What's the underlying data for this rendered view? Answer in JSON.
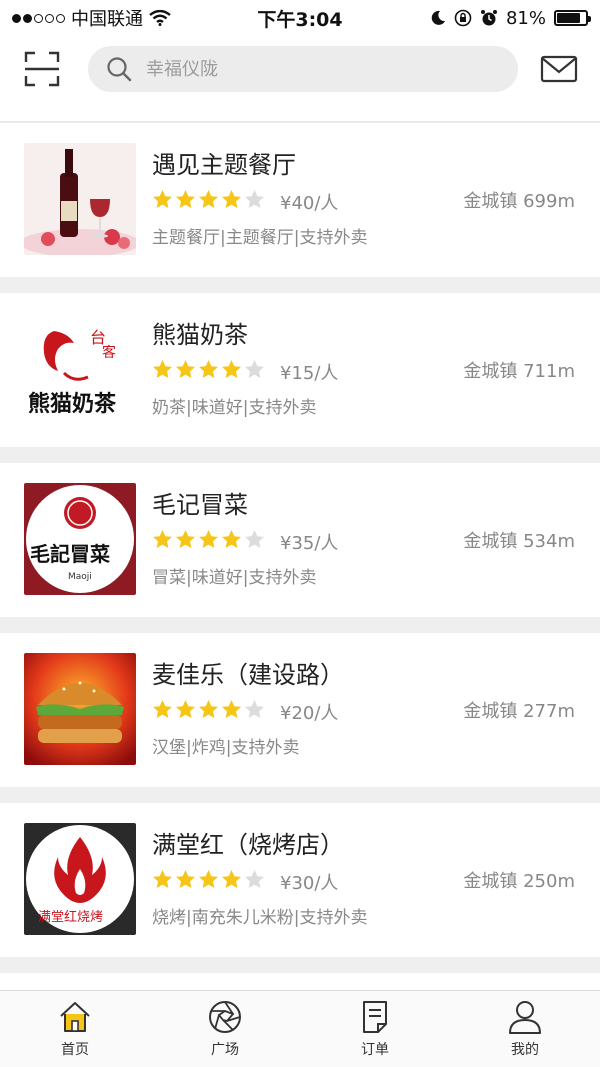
{
  "status_bar": {
    "carrier": "中国联通",
    "time": "下午3:04",
    "battery": "81%",
    "battery_level": 0.81
  },
  "header": {
    "search_placeholder": "幸福仪陇"
  },
  "colors": {
    "star_filled": "#f5c518",
    "star_empty": "#dcdcdc",
    "accent_active": "#f5c518"
  },
  "restaurants": [
    {
      "name": "遇见主题餐厅",
      "rating": 4,
      "price": "¥40/人",
      "distance": "金城镇 699m",
      "tags": "主题餐厅|主题餐厅|支持外卖",
      "thumb_icon": "wine-bottle-icon"
    },
    {
      "name": "熊猫奶茶",
      "rating": 4,
      "price": "¥15/人",
      "distance": "金城镇 711m",
      "tags": "奶茶|味道好|支持外卖",
      "thumb_icon": "milk-tea-logo-icon",
      "logo_text": "熊猫奶茶"
    },
    {
      "name": "毛记冒菜",
      "rating": 4,
      "price": "¥35/人",
      "distance": "金城镇 534m",
      "tags": "冒菜|味道好|支持外卖",
      "thumb_icon": "maoji-logo-icon",
      "logo_text": "毛記冒菜",
      "logo_subtext": "Maoji"
    },
    {
      "name": "麦佳乐（建设路）",
      "rating": 4,
      "price": "¥20/人",
      "distance": "金城镇 277m",
      "tags": "汉堡|炸鸡|支持外卖",
      "thumb_icon": "burger-icon"
    },
    {
      "name": "满堂红（烧烤店）",
      "rating": 4,
      "price": "¥30/人",
      "distance": "金城镇 250m",
      "tags": "烧烤|南充朱儿米粉|支持外卖",
      "thumb_icon": "flame-logo-icon",
      "logo_text": "满堂红烧烤"
    }
  ],
  "tabs": [
    {
      "label": "首页",
      "icon": "home-icon",
      "active": true
    },
    {
      "label": "广场",
      "icon": "aperture-icon",
      "active": false
    },
    {
      "label": "订单",
      "icon": "order-doc-icon",
      "active": false
    },
    {
      "label": "我的",
      "icon": "user-icon",
      "active": false
    }
  ]
}
